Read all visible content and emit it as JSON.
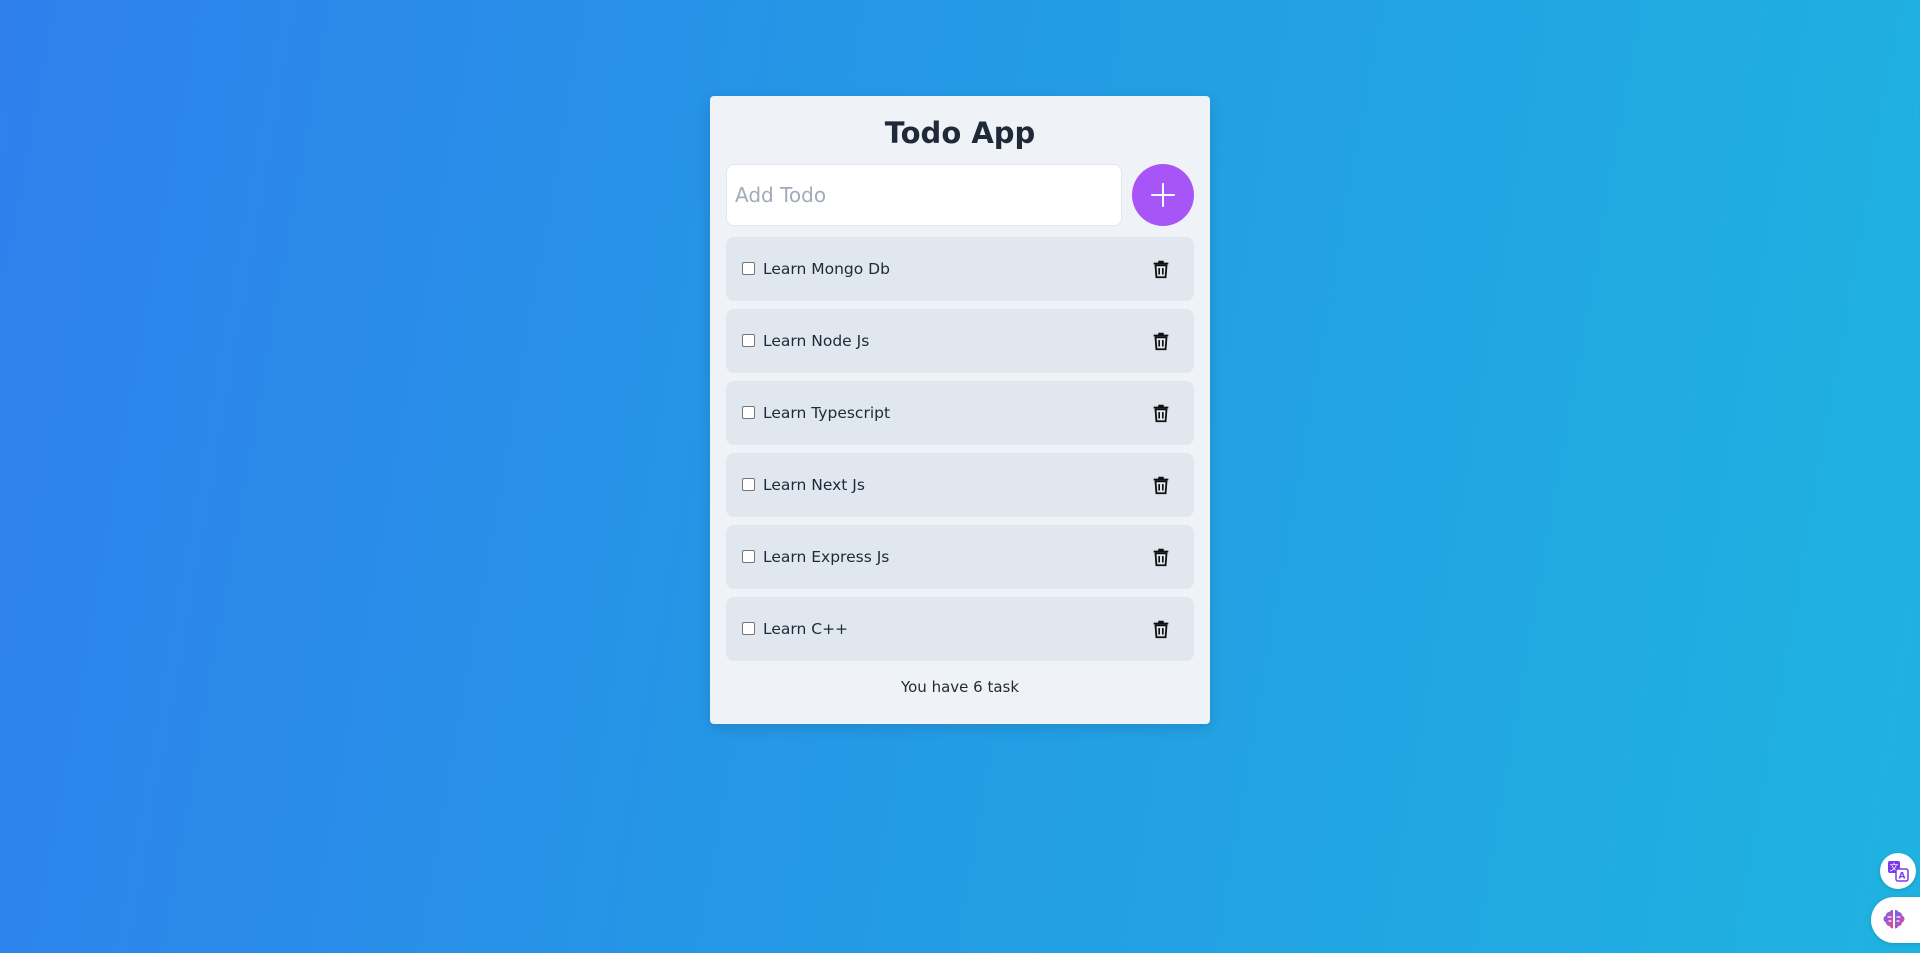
{
  "app": {
    "title": "Todo App"
  },
  "add_todo": {
    "placeholder": "Add Todo",
    "value": "",
    "button_icon": "plus-icon",
    "button_color": "#a855f7"
  },
  "todos": [
    {
      "label": "Learn Mongo Db",
      "done": false
    },
    {
      "label": "Learn Node Js",
      "done": false
    },
    {
      "label": "Learn Typescript",
      "done": false
    },
    {
      "label": "Learn Next Js",
      "done": false
    },
    {
      "label": "Learn Express Js",
      "done": false
    },
    {
      "label": "Learn C++",
      "done": false
    }
  ],
  "footer": {
    "text": "You have 6 task"
  },
  "colors": {
    "background_start": "#2f80ed",
    "background_end": "#1fb3e0",
    "card": "#eff3f8",
    "item": "#e1e7ef"
  },
  "floating_widgets": [
    {
      "icon": "translate-icon"
    },
    {
      "icon": "brain-icon"
    }
  ]
}
